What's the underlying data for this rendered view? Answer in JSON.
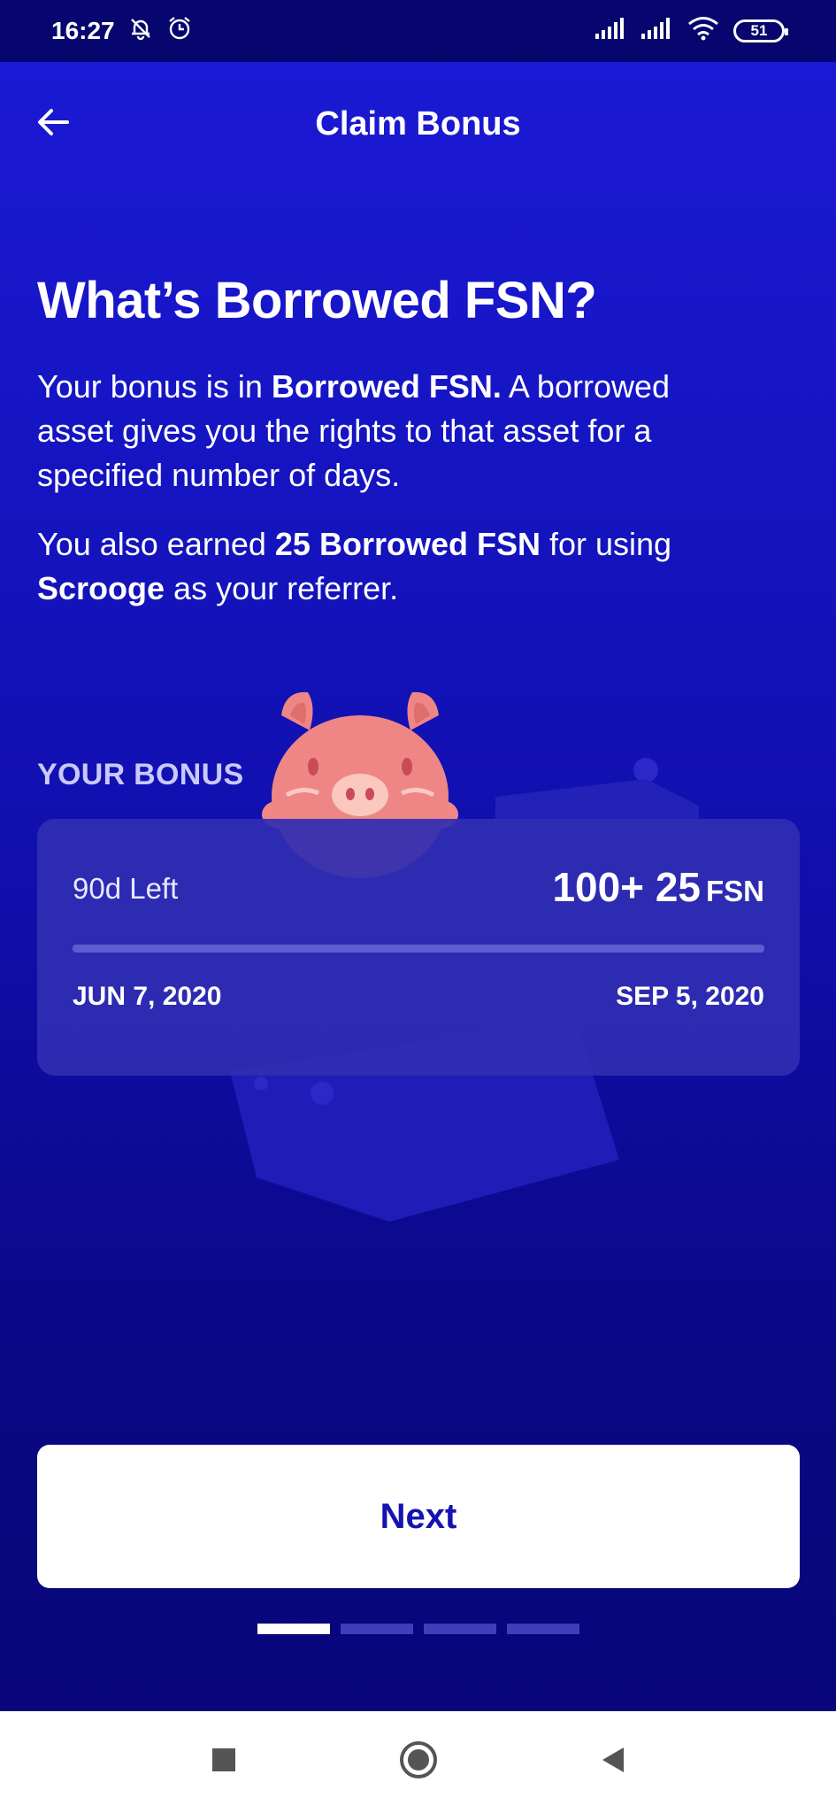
{
  "status_bar": {
    "time": "16:27",
    "battery": "51"
  },
  "header": {
    "title": "Claim Bonus"
  },
  "content": {
    "headline": "What’s Borrowed FSN?",
    "para1_prefix": "Your bonus is in ",
    "para1_bold": "Borrowed FSN.",
    "para1_suffix": " A borrowed asset gives you the rights to that asset for a specified number of days.",
    "para2_a": "You also earned ",
    "para2_bold1": "25 Borrowed FSN",
    "para2_b": " for using ",
    "para2_bold2": "Scrooge",
    "para2_c": " as your referrer."
  },
  "bonus": {
    "label": "YOUR BONUS",
    "days_left": "90d Left",
    "amount": "100+ 25",
    "unit": "FSN",
    "start_date": "JUN 7, 2020",
    "end_date": "SEP 5, 2020",
    "progress": 0
  },
  "footer": {
    "next_label": "Next",
    "pager_count": 4,
    "pager_active": 0
  },
  "colors": {
    "accent": "#1513b0",
    "background": "#1615c4",
    "card": "#302eb2"
  },
  "icons": [
    "mute-icon",
    "alarm-icon",
    "signal-icon",
    "wifi-icon",
    "battery-icon",
    "back-arrow-icon",
    "piggy-icon",
    "square-nav-icon",
    "home-nav-icon",
    "back-nav-icon"
  ]
}
